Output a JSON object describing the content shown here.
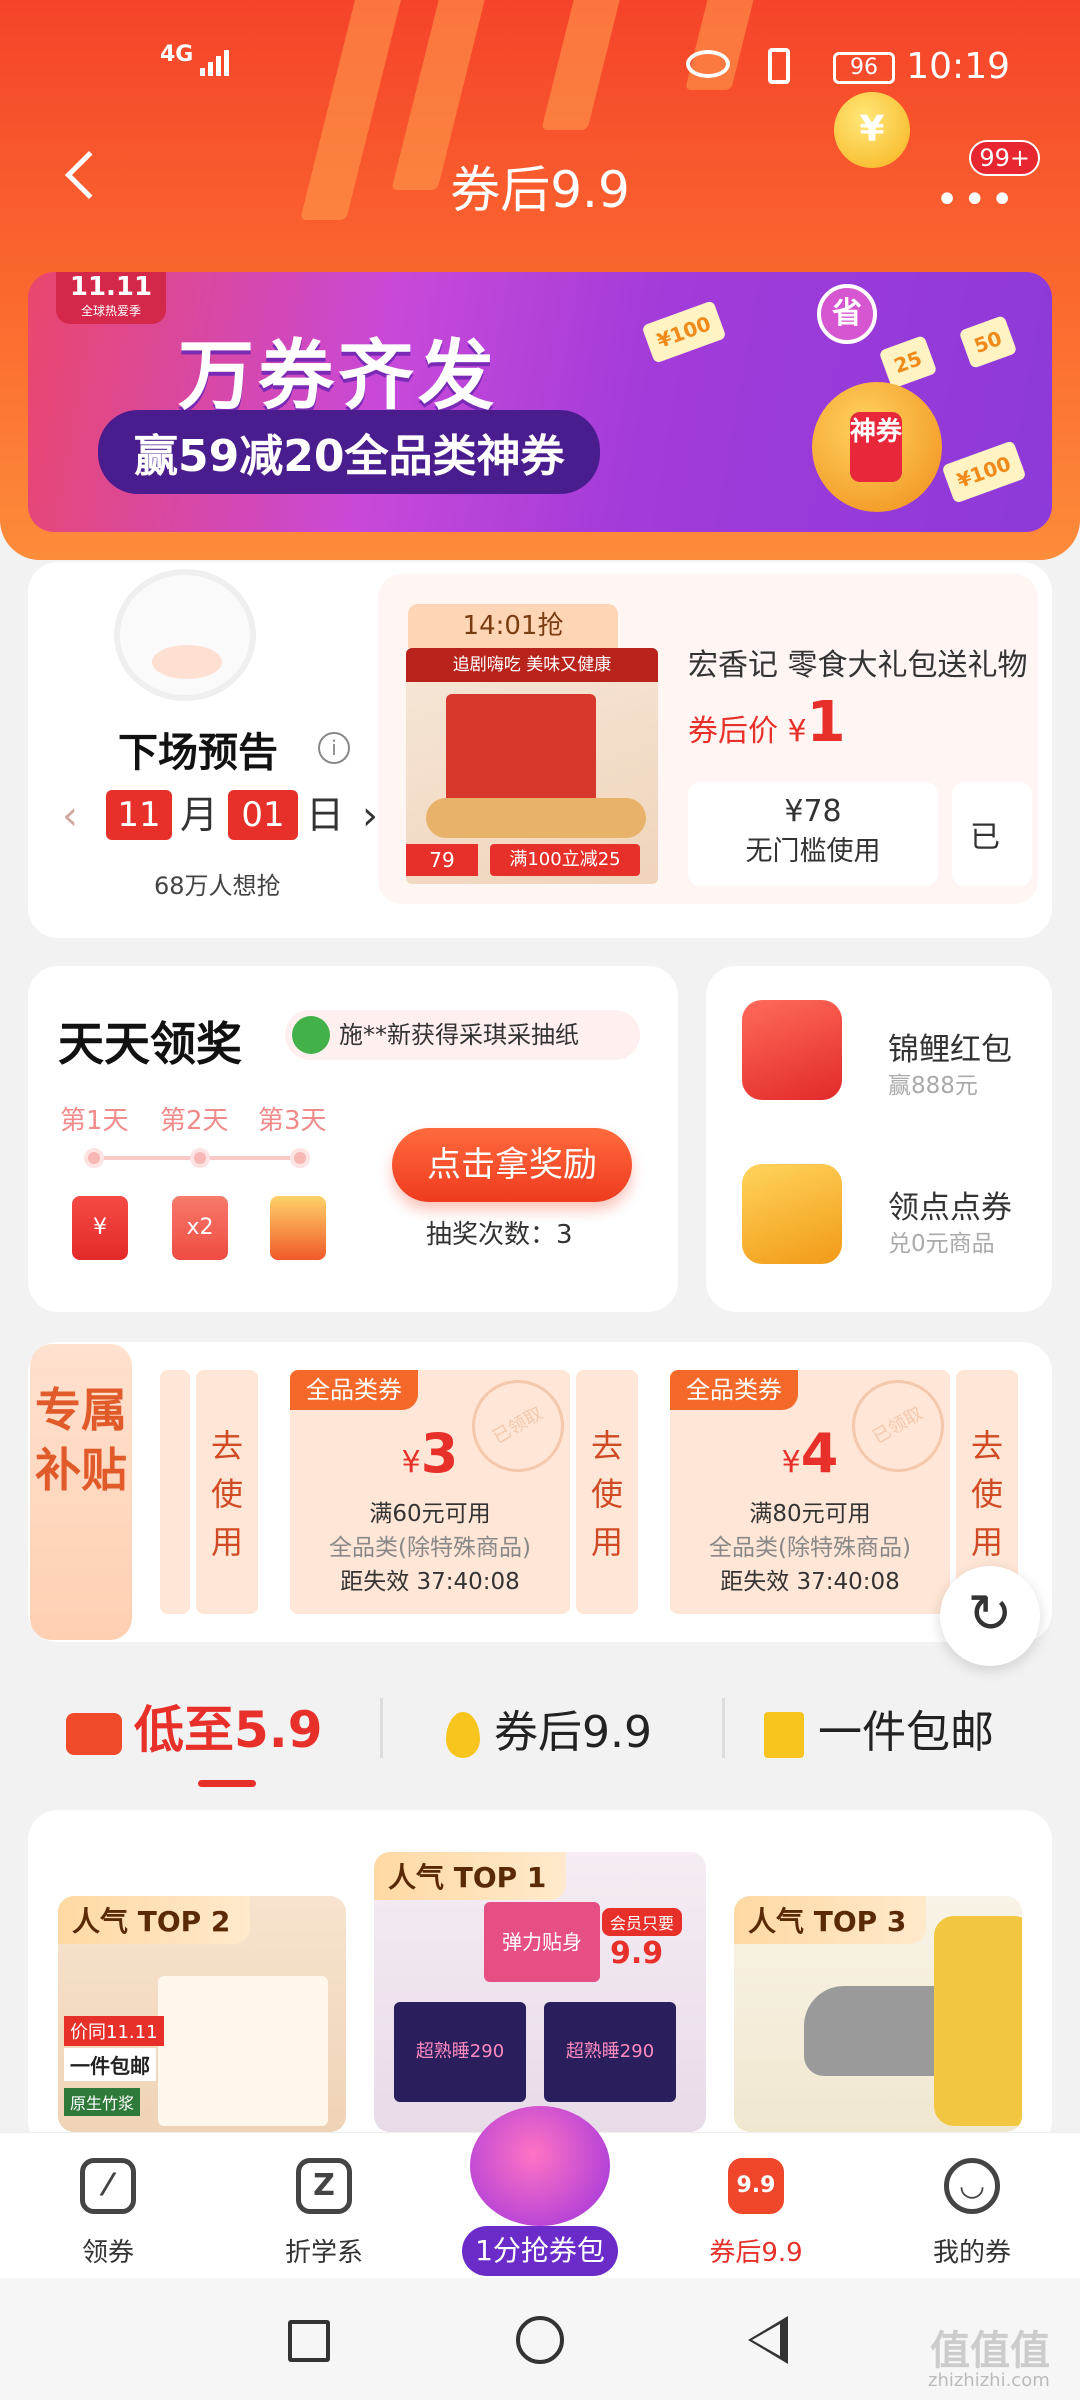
{
  "status": {
    "network": "4G",
    "battery": "96",
    "time": "10:19"
  },
  "header": {
    "title": "券后9.9",
    "badge": "99+",
    "coin": "¥"
  },
  "banner": {
    "tag_top": "11.11",
    "tag_sub": "全球热爱季",
    "headline": "万券齐发",
    "subline": "赢59减20全品类神券",
    "claw_text": "省",
    "capsule_text": "神券",
    "tickets": [
      "¥100",
      "50",
      "¥100",
      "25"
    ]
  },
  "preview": {
    "label": "下场预告",
    "info_icon": "i",
    "month": "11",
    "month_unit": "月",
    "day": "01",
    "day_unit": "日",
    "want_count": "68万人想抢",
    "product": {
      "time": "14:01抢",
      "name": "宏香记 零食大礼包送礼物",
      "price_prefix": "券后价 ¥",
      "price": "1",
      "coupon_amount": "¥78",
      "coupon_condition": "无门槛使用",
      "img_tagline": "追剧嗨吃 美味又健康",
      "img_promo": "满100立减25",
      "img_price": "79",
      "coupon2_text": "已"
    }
  },
  "daily": {
    "title": "天天领奖",
    "winner_text": "施**新获得采琪采抽纸",
    "days": [
      "第1天",
      "第2天",
      "第3天"
    ],
    "gift2_label": "x2",
    "claim_button": "点击拿奖励",
    "draws_label": "抽奖次数：",
    "draws_count": "3"
  },
  "side": [
    {
      "title": "锦鲤红包",
      "sub": "赢888元",
      "icon": "koi-redpacket-icon"
    },
    {
      "title": "领点点券",
      "sub": "兑0元商品",
      "icon": "coupon-ticket-icon"
    }
  ],
  "exclusive": {
    "tab_label": "专属补贴",
    "use_label": "去使用",
    "coupons": [
      {
        "tag": "全品类券",
        "amount": "3",
        "condition": "满60元可用",
        "scope": "全品类(除特殊商品)",
        "expire": "距失效 37:40:08"
      },
      {
        "tag": "全品类券",
        "amount": "4",
        "condition": "满80元可用",
        "scope": "全品类(除特殊商品)",
        "expire": "距失效 37:40:08"
      }
    ],
    "stamp": "已领取"
  },
  "tabs": [
    "低至5.9",
    "券后9.9",
    "一件包邮"
  ],
  "products": [
    {
      "tag": "人气 TOP 2",
      "promo1": "价同11.11",
      "promo2": "一件包邮",
      "promo3": "原生竹浆"
    },
    {
      "tag": "人气 TOP 1",
      "promo1": "会员只要",
      "promo2": "9.9",
      "brand1": "弹力贴身",
      "brand2": "超熟睡290"
    },
    {
      "tag": "人气 TOP 3"
    }
  ],
  "bottom_nav": [
    {
      "label": "领券",
      "icon": "coupon-nav-icon"
    },
    {
      "label": "折学系",
      "icon": "z-nav-icon"
    },
    {
      "label": "1分抢券包",
      "icon": "coupon-pack-icon"
    },
    {
      "label": "券后9.9",
      "icon": "9.9"
    },
    {
      "label": "我的券",
      "icon": "smile-nav-icon"
    }
  ],
  "watermark": {
    "logo": "值值值",
    "url": "zhizhizhi.com"
  }
}
